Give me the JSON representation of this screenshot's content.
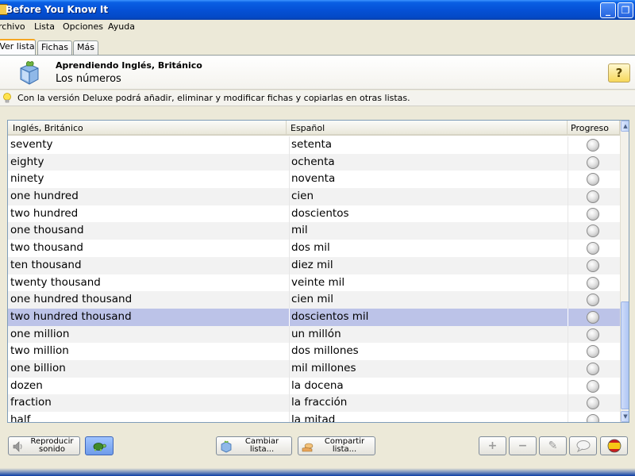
{
  "window": {
    "title": "Before You Know It",
    "minimize": "_",
    "maximize": "❐",
    "close": "✕"
  },
  "menu": [
    "rchivo",
    "Lista",
    "Opciones",
    "Ayuda"
  ],
  "tabs": [
    {
      "label": "Ver lista",
      "active": true
    },
    {
      "label": "Fichas",
      "active": false
    },
    {
      "label": "Más",
      "active": false
    }
  ],
  "header": {
    "course": "Aprendiendo Inglés, Británico",
    "list_name": "Los números",
    "help_label": "?"
  },
  "info": {
    "text": "Con la versión Deluxe podrá añadir, eliminar y modificar fichas y copiarlas en otras listas."
  },
  "table": {
    "columns": [
      "Inglés, Británico",
      "Español",
      "Progreso"
    ],
    "rows": [
      {
        "en": "seventy",
        "es": "setenta"
      },
      {
        "en": "eighty",
        "es": "ochenta"
      },
      {
        "en": "ninety",
        "es": "noventa"
      },
      {
        "en": "one hundred",
        "es": "cien"
      },
      {
        "en": "two hundred",
        "es": "doscientos"
      },
      {
        "en": "one thousand",
        "es": "mil"
      },
      {
        "en": "two thousand",
        "es": "dos mil"
      },
      {
        "en": "ten thousand",
        "es": "diez mil"
      },
      {
        "en": "twenty thousand",
        "es": "veinte mil"
      },
      {
        "en": "one hundred thousand",
        "es": "cien mil"
      },
      {
        "en": "two hundred thousand",
        "es": "doscientos mil",
        "selected": true
      },
      {
        "en": "one million",
        "es": "un millón"
      },
      {
        "en": "two million",
        "es": "dos millones"
      },
      {
        "en": "one billion",
        "es": "mil millones"
      },
      {
        "en": "dozen",
        "es": "la docena"
      },
      {
        "en": "fraction",
        "es": "la fracción"
      },
      {
        "en": "half",
        "es": "la mitad"
      }
    ]
  },
  "toolbar": {
    "play_label": "Reproducir sonido",
    "cambiar_label": "Cambiar lista...",
    "compartir_label": "Compartir lista...",
    "add_glyph": "+",
    "remove_glyph": "−",
    "edit_glyph": "✎",
    "chat_glyph": "💬"
  },
  "colors": {
    "selected_row": "#bcc3e8",
    "alt_row": "#f2f2f2",
    "titlebar": "#0551d6"
  }
}
